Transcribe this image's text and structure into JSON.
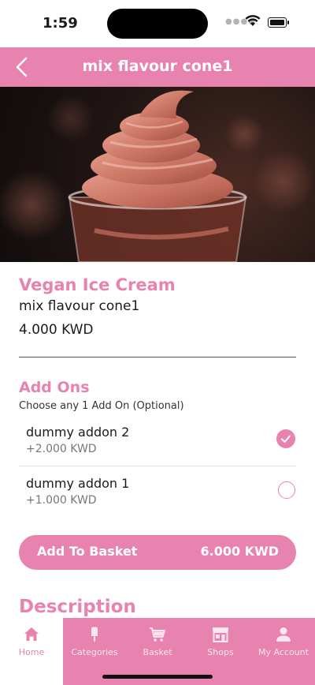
{
  "status_bar": {
    "time": "1:59"
  },
  "header": {
    "title": "mix flavour cone1"
  },
  "product": {
    "category": "Vegan Ice Cream",
    "name": "mix flavour cone1",
    "price": "4.000 KWD"
  },
  "addons": {
    "title": "Add Ons",
    "subtitle": "Choose any 1 Add On (Optional)",
    "items": [
      {
        "name": "dummy addon 2",
        "price": "+2.000 KWD",
        "selected": true
      },
      {
        "name": "dummy addon 1",
        "price": "+1.000 KWD",
        "selected": false
      }
    ]
  },
  "basket_button": {
    "label": "Add To Basket",
    "total": "6.000 KWD"
  },
  "description": {
    "title": "Description"
  },
  "nav": {
    "tabs": [
      {
        "label": "Home",
        "icon": "home-icon",
        "active": true
      },
      {
        "label": "Categories",
        "icon": "ice-cream-icon",
        "active": false
      },
      {
        "label": "Basket",
        "icon": "cart-icon",
        "active": false
      },
      {
        "label": "Shops",
        "icon": "shop-icon",
        "active": false
      },
      {
        "label": "My Account",
        "icon": "user-icon",
        "active": false
      }
    ]
  },
  "colors": {
    "accent": "#e882ae",
    "text": "#1b1b1b"
  }
}
